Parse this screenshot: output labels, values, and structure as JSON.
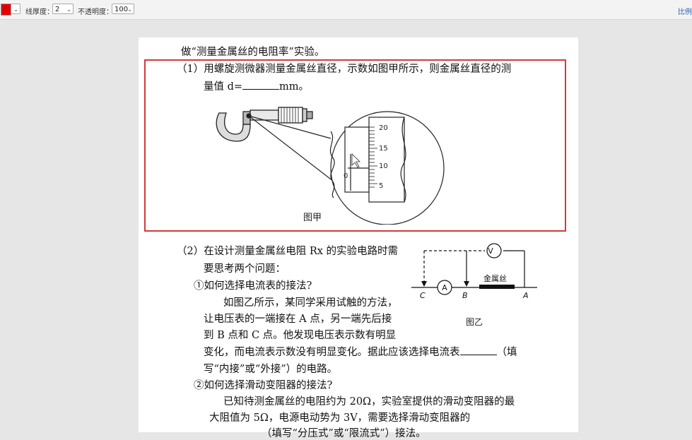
{
  "toolbar": {
    "color_picker": {
      "color": "#e00000"
    },
    "thickness_label": "线厚度：",
    "thickness_value": "2",
    "opacity_label": "不透明度：",
    "opacity_value": "100",
    "right_text": "比例"
  },
  "doc": {
    "title": "做“测量金属丝的电阻率”实验。",
    "q1_line1": "（1）用螺旋测微器测量金属丝直径，示数如图甲所示，则金属丝直径的测",
    "q1_line2_a": "量值 d=",
    "q1_line2_b": "mm。",
    "fig_jia": {
      "caption": "图甲",
      "scale": [
        "20",
        "15",
        "10",
        "5"
      ],
      "zero": "0"
    },
    "q2_line1": "（2）在设计测量金属丝电阻 Rx 的实验电路时需",
    "q2_line2": "要思考两个问题：",
    "q2_sub1": "①如何选择电流表的接法?",
    "q2_p1": "如图乙所示，某同学采用试触的方法，",
    "q2_p2": "让电压表的一端接在 A 点，另一端先后接",
    "q2_p3": "到 B 点和 C 点。他发现电压表示数有明显",
    "q2_p4_a": "变化，而电流表示数没有明显变化。据此应该选择电流表",
    "q2_p4_b": "（填",
    "q2_p5": "写“内接”或“外接”）的电路。",
    "q2_sub2": "②如何选择滑动变阻器的接法?",
    "q2_p6": "已知待测金属丝的电阻约为 20Ω，实验室提供的滑动变阻器的最",
    "q2_p7": "大阻值为 5Ω，电源电动势为 3V，需要选择滑动变阻器的",
    "q2_p8": "（填写“分压式”或“限流式”）接法。",
    "fig_yi": {
      "caption": "图乙",
      "voltmeter": "V",
      "ammeter": "A",
      "wire_label": "金属丝",
      "point_c": "C",
      "point_b": "B",
      "point_a": "A"
    }
  }
}
